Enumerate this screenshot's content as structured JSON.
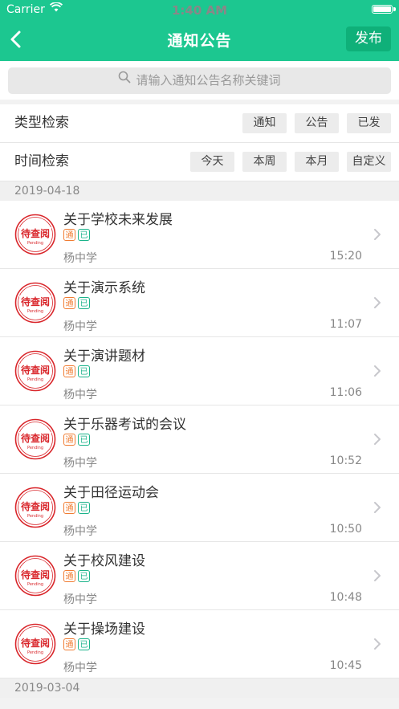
{
  "status_bar": {
    "carrier": "Carrier",
    "time": "1:40 AM"
  },
  "nav": {
    "title": "通知公告",
    "publish_label": "发布"
  },
  "search": {
    "placeholder": "请输入通知公告名称关键词"
  },
  "filters": {
    "type": {
      "label": "类型检索",
      "options": [
        "通知",
        "公告",
        "已发"
      ]
    },
    "time": {
      "label": "时间检索",
      "options": [
        "今天",
        "本周",
        "本月",
        "自定义"
      ]
    }
  },
  "groups": [
    {
      "date": "2019-04-18",
      "items": [
        {
          "title": "关于学校未来发展",
          "badge_type": "通",
          "badge_status": "已",
          "sender": "杨中学",
          "time": "15:20",
          "stamp_text": "待查阅",
          "stamp_sub": "Pending"
        },
        {
          "title": "关于演示系统",
          "badge_type": "通",
          "badge_status": "已",
          "sender": "杨中学",
          "time": "11:07",
          "stamp_text": "待查阅",
          "stamp_sub": "Pending"
        },
        {
          "title": "关于演讲题材",
          "badge_type": "通",
          "badge_status": "已",
          "sender": "杨中学",
          "time": "11:06",
          "stamp_text": "待查阅",
          "stamp_sub": "Pending"
        },
        {
          "title": "关于乐器考试的会议",
          "badge_type": "通",
          "badge_status": "已",
          "sender": "杨中学",
          "time": "10:52",
          "stamp_text": "待查阅",
          "stamp_sub": "Pending"
        },
        {
          "title": "关于田径运动会",
          "badge_type": "通",
          "badge_status": "已",
          "sender": "杨中学",
          "time": "10:50",
          "stamp_text": "待查阅",
          "stamp_sub": "Pending"
        },
        {
          "title": "关于校风建设",
          "badge_type": "通",
          "badge_status": "已",
          "sender": "杨中学",
          "time": "10:48",
          "stamp_text": "待查阅",
          "stamp_sub": "Pending"
        },
        {
          "title": "关于操场建设",
          "badge_type": "通",
          "badge_status": "已",
          "sender": "杨中学",
          "time": "10:45",
          "stamp_text": "待查阅",
          "stamp_sub": "Pending"
        }
      ]
    },
    {
      "date": "2019-03-04",
      "items": []
    }
  ],
  "colors": {
    "primary": "#1cc790",
    "publish_bg": "#0fb079",
    "stamp_red": "#d9262b",
    "badge_orange": "#f07c32",
    "badge_teal": "#1ab38a"
  },
  "icons": {
    "back": "chevron-left-icon",
    "search": "search-icon",
    "row_arrow": "chevron-right-icon",
    "wifi": "wifi-icon",
    "battery": "battery-icon"
  }
}
